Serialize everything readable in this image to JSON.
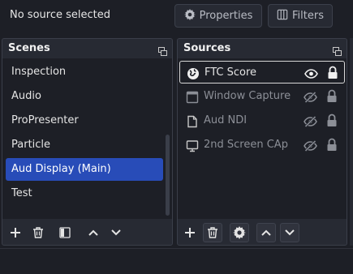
{
  "topbar": {
    "status": "No source selected",
    "properties_label": "Properties",
    "filters_label": "Filters"
  },
  "scenes": {
    "title": "Scenes",
    "items": [
      {
        "label": "Inspection"
      },
      {
        "label": "Audio"
      },
      {
        "label": "ProPresenter"
      },
      {
        "label": "Particle"
      },
      {
        "label": "Aud Display (Main)",
        "selected": true
      },
      {
        "label": "Test"
      }
    ]
  },
  "sources": {
    "title": "Sources",
    "items": [
      {
        "label": "FTC Score",
        "icon": "browser-globe-icon",
        "visible": true,
        "selected": true
      },
      {
        "label": "Window Capture",
        "icon": "window-capture-icon",
        "visible": false
      },
      {
        "label": "Aud NDI",
        "icon": "file-icon",
        "visible": false
      },
      {
        "label": "2nd Screen CAp",
        "icon": "monitor-icon",
        "visible": false
      }
    ]
  },
  "colors": {
    "background": "#1d1f26",
    "panel": "#272a33",
    "selection": "#284cb8",
    "border": "#3a3e49"
  }
}
